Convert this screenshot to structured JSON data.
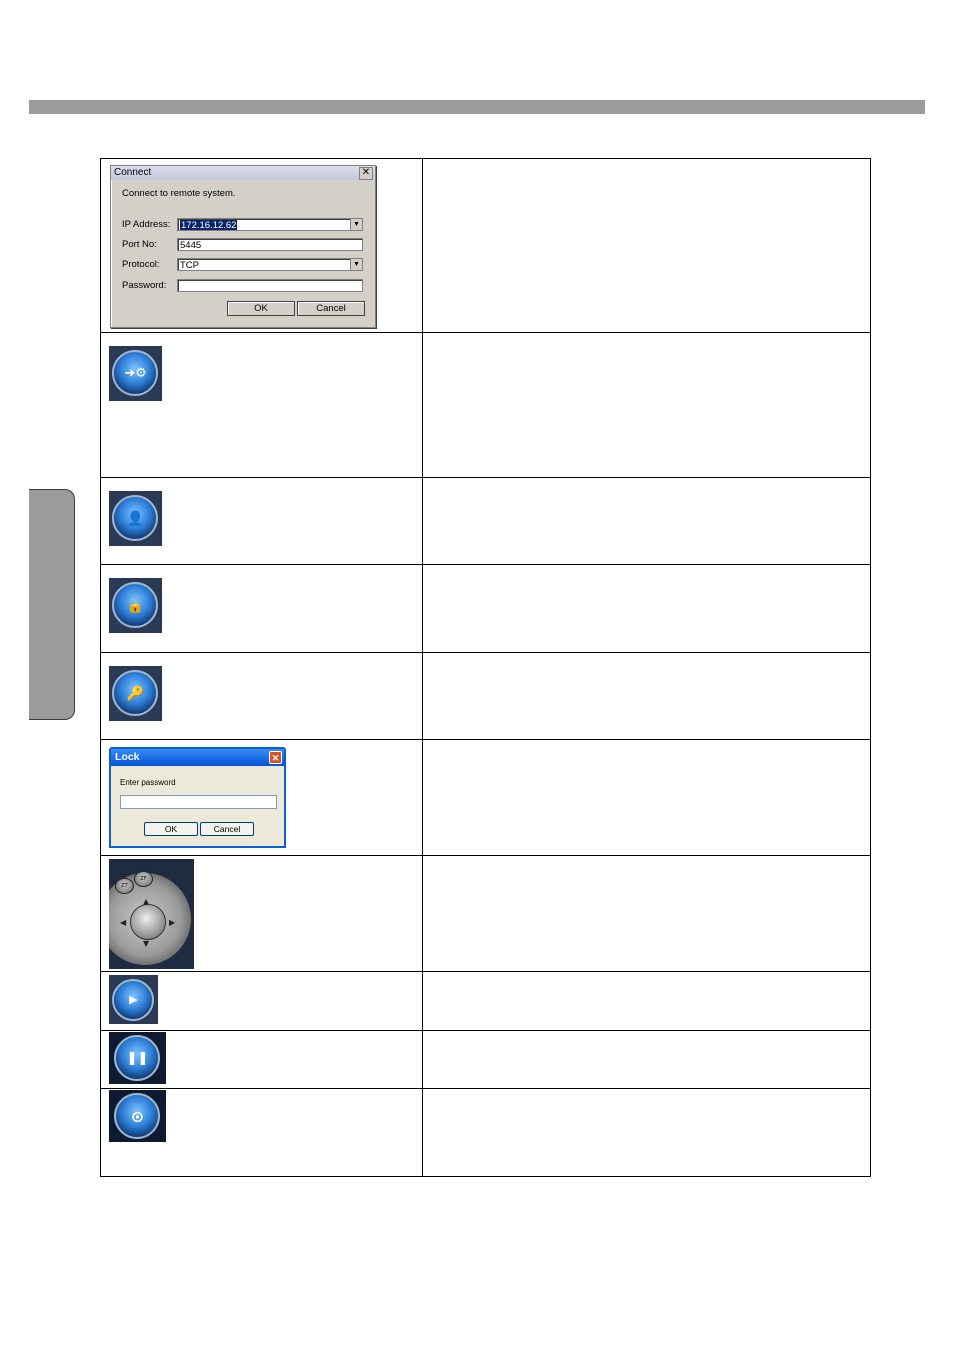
{
  "connect_dialog": {
    "title": "Connect",
    "close": "✕",
    "prompt": "Connect to remote system.",
    "ip_label": "IP Address:",
    "ip_value": "172.16.12.62",
    "port_label": "Port No:",
    "port_value": "5445",
    "protocol_label": "Protocol:",
    "protocol_value": "TCP",
    "password_label": "Password:",
    "password_value": "",
    "ok": "OK",
    "cancel": "Cancel"
  },
  "lock_dialog": {
    "title": "Lock",
    "close": "✕",
    "prompt": "Enter password",
    "password_value": "",
    "ok": "OK",
    "cancel": "Cancel"
  },
  "ptz": {
    "zoom_out_label": "ZT",
    "zoom_in_label": "ZF"
  },
  "icons": [
    {
      "name": "connect-icon",
      "glyph": "➜⚙"
    },
    {
      "name": "user-login-icon",
      "glyph": "👤"
    },
    {
      "name": "lock-icon",
      "glyph": "🔓"
    },
    {
      "name": "key-icon",
      "glyph": "🔑"
    },
    {
      "name": "play-icon",
      "glyph": "▶"
    },
    {
      "name": "pause-icon",
      "glyph": "❚❚"
    },
    {
      "name": "capture-icon",
      "glyph": "⊙"
    }
  ]
}
